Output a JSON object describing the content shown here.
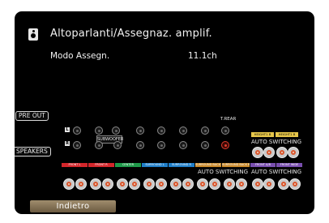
{
  "header": {
    "title": "Altoparlanti/Assegnaz. amplif.",
    "setting_label": "Modo Assegn.",
    "setting_value": "11.1ch"
  },
  "panel": {
    "pre_out_label": "PRE OUT",
    "speakers_label": "SPEAKERS",
    "subwoofer_label": "SUBWOOFER",
    "t_rear_label": "T.REAR",
    "l_marker": "L",
    "r_marker": "R",
    "auto_switching_label": "AUTO SWITCHING",
    "height_labels": [
      "HEIGHT1 B",
      "HEIGHT1 B"
    ],
    "channel_strips": [
      {
        "label": "FRONT L",
        "color": "#d3262b"
      },
      {
        "label": "FRONT R",
        "color": "#d3262b"
      },
      {
        "label": "CENTER",
        "color": "#1f9a4a"
      },
      {
        "label": "SURROUND L",
        "color": "#1f7ec8"
      },
      {
        "label": "SURROUND R",
        "color": "#1f7ec8"
      },
      {
        "label": "SURROUND BACK L",
        "color": "#c9892a"
      },
      {
        "label": "SURROUND BACK R",
        "color": "#c9892a"
      },
      {
        "label": "FRONT A/B",
        "color": "#7a4fb0"
      },
      {
        "label": "FRONT WIDE",
        "color": "#7a4fb0"
      }
    ],
    "polarity_plus": "+",
    "polarity_minus": "−"
  },
  "footer": {
    "back_label": "Indietro"
  },
  "colors": {
    "screen_bg": "#000000",
    "text": "#f2f2f2",
    "button_bg": "#8a7755",
    "accent_red": "#e03b2c",
    "terminal_orange": "#d9552c",
    "height_yellow": "#e6c64a"
  }
}
